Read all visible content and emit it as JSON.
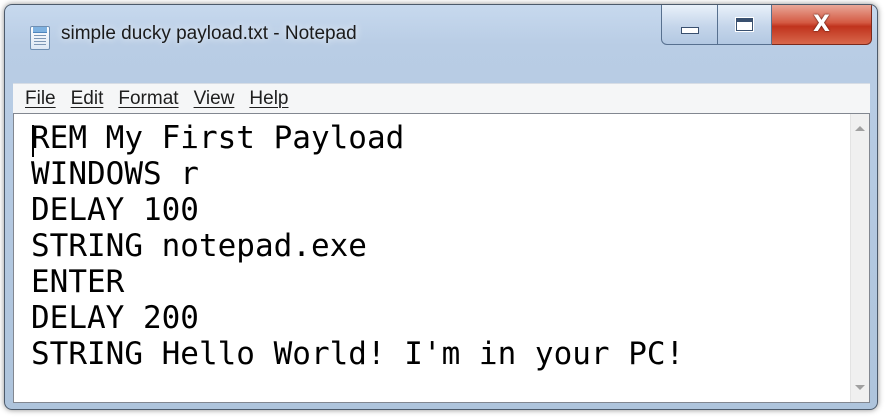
{
  "window": {
    "title": "simple ducky payload.txt - Notepad",
    "app_icon": "notepad-icon",
    "controls": {
      "minimize": "minimize-icon",
      "maximize": "maximize-icon",
      "close_label": "X"
    }
  },
  "menu": [
    "File",
    "Edit",
    "Format",
    "View",
    "Help"
  ],
  "editor": {
    "lines": [
      "REM My First Payload",
      "WINDOWS r",
      "DELAY 100",
      "STRING notepad.exe",
      "ENTER",
      "DELAY 200",
      "STRING Hello World! I'm in your PC!"
    ]
  },
  "colors": {
    "close_button": "#c0331d",
    "title_bar": "#b9cde5"
  }
}
